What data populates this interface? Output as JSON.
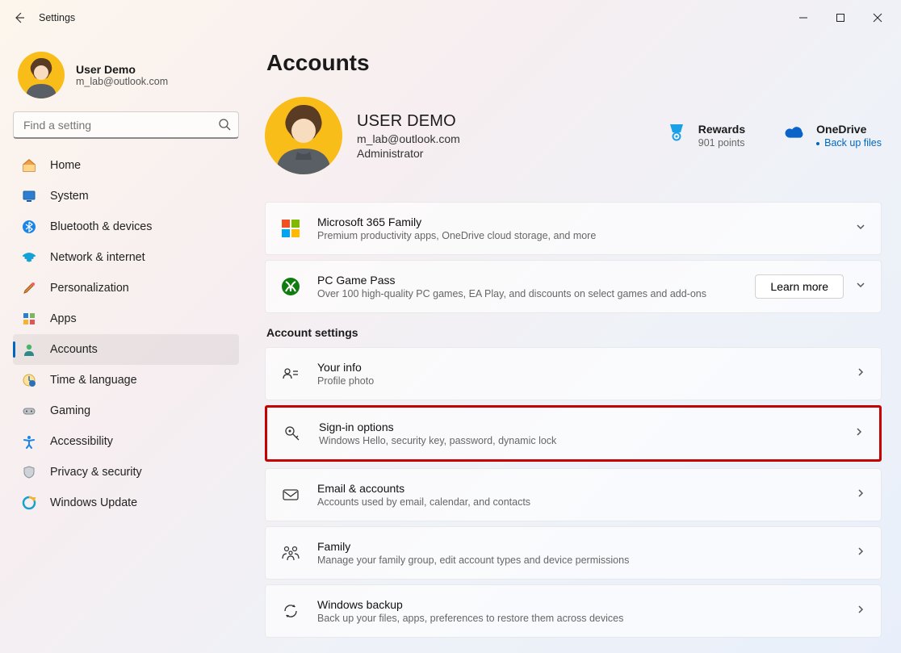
{
  "window": {
    "title": "Settings"
  },
  "sidebar": {
    "user_name": "User Demo",
    "user_email": "m_lab@outlook.com",
    "search_placeholder": "Find a setting",
    "items": [
      {
        "label": "Home"
      },
      {
        "label": "System"
      },
      {
        "label": "Bluetooth & devices"
      },
      {
        "label": "Network & internet"
      },
      {
        "label": "Personalization"
      },
      {
        "label": "Apps"
      },
      {
        "label": "Accounts"
      },
      {
        "label": "Time & language"
      },
      {
        "label": "Gaming"
      },
      {
        "label": "Accessibility"
      },
      {
        "label": "Privacy & security"
      },
      {
        "label": "Windows Update"
      }
    ]
  },
  "page": {
    "title": "Accounts",
    "account": {
      "name": "USER DEMO",
      "email": "m_lab@outlook.com",
      "role": "Administrator"
    },
    "rewards": {
      "title": "Rewards",
      "sub": "901 points"
    },
    "onedrive": {
      "title": "OneDrive",
      "sub": "Back up files"
    },
    "promo": [
      {
        "title": "Microsoft 365 Family",
        "sub": "Premium productivity apps, OneDrive cloud storage, and more"
      },
      {
        "title": "PC Game Pass",
        "sub": "Over 100 high-quality PC games, EA Play, and discounts on select games and add-ons",
        "cta": "Learn more"
      }
    ],
    "section_label": "Account settings",
    "settings": [
      {
        "title": "Your info",
        "sub": "Profile photo"
      },
      {
        "title": "Sign-in options",
        "sub": "Windows Hello, security key, password, dynamic lock"
      },
      {
        "title": "Email & accounts",
        "sub": "Accounts used by email, calendar, and contacts"
      },
      {
        "title": "Family",
        "sub": "Manage your family group, edit account types and device permissions"
      },
      {
        "title": "Windows backup",
        "sub": "Back up your files, apps, preferences to restore them across devices"
      }
    ]
  }
}
